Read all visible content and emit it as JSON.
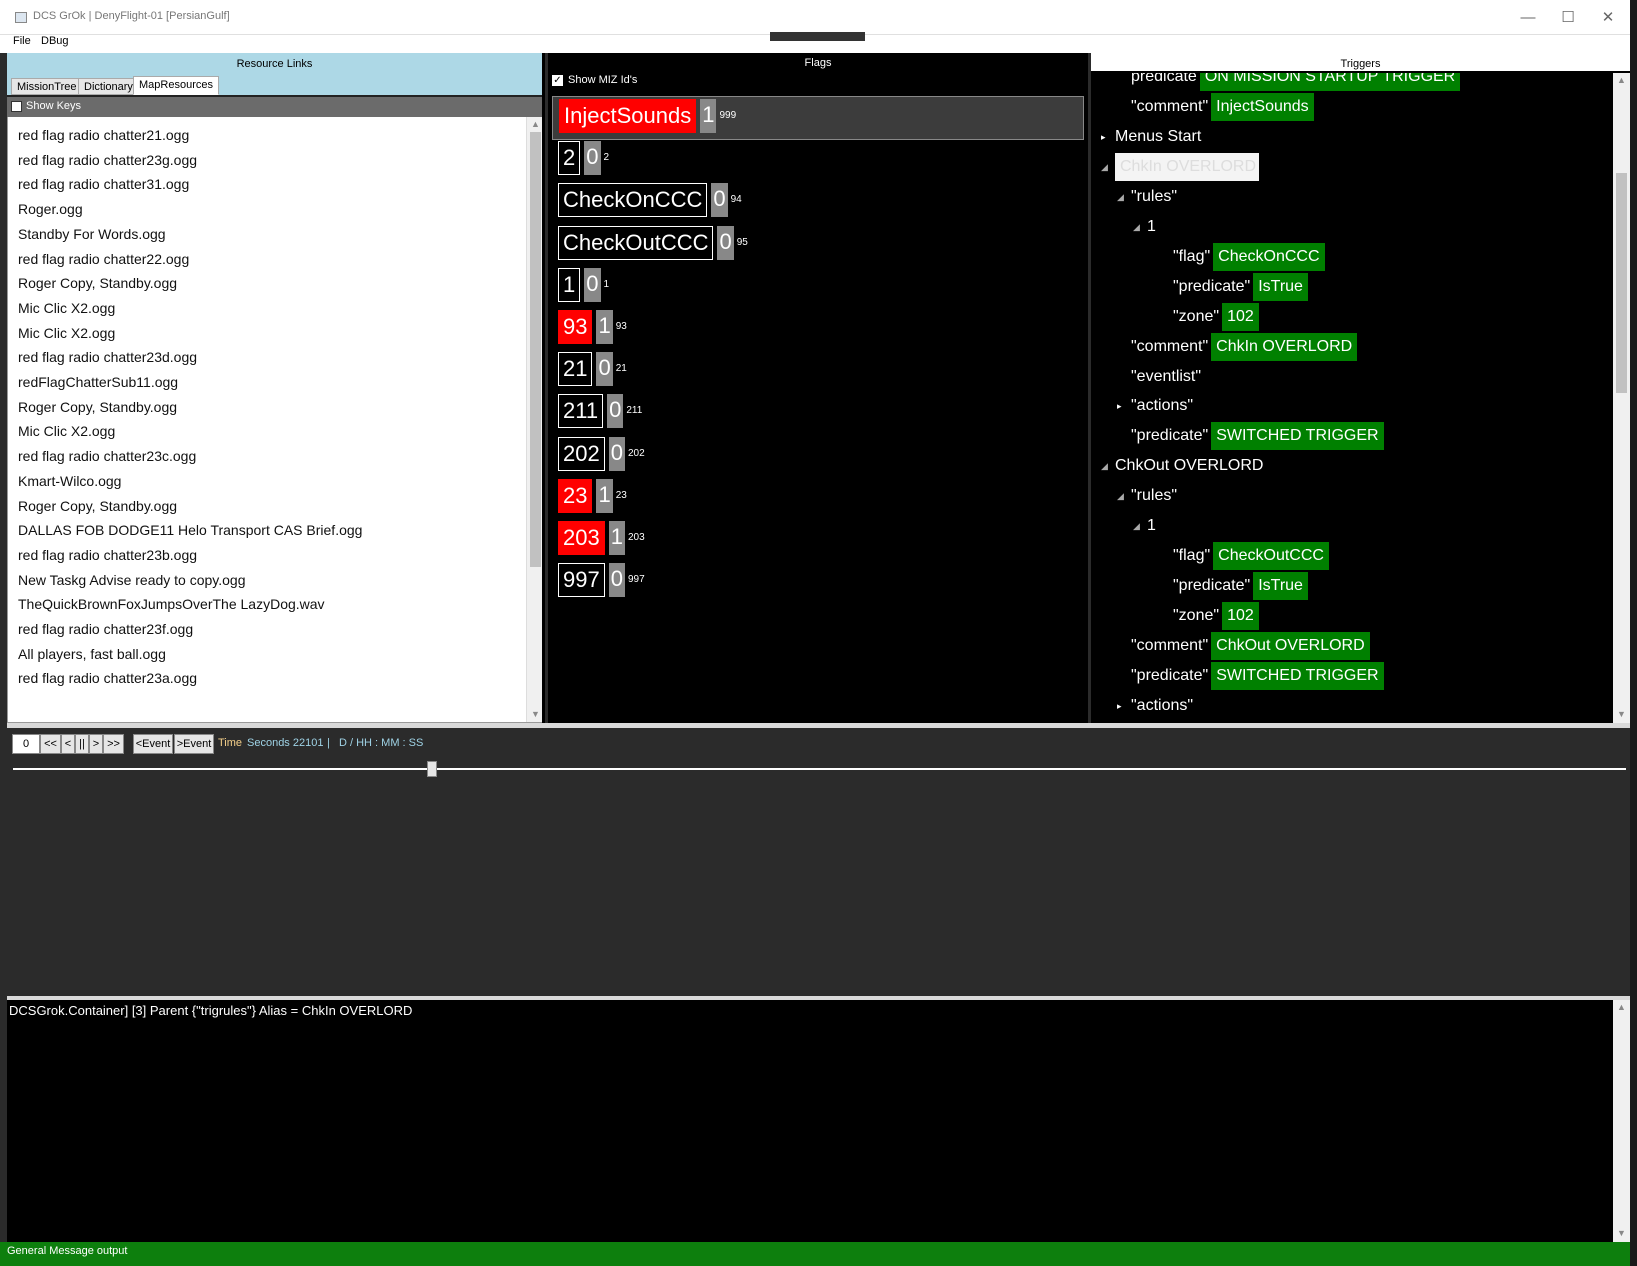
{
  "window": {
    "title": "DCS GrOk | DenyFlight-01 [PersianGulf]",
    "min_glyph": "—",
    "max_glyph": "☐",
    "close_glyph": "✕"
  },
  "menu": {
    "file": "File",
    "dbug": "DBug"
  },
  "resources": {
    "header": "Resource Links",
    "tabs": [
      "MissionTree",
      "Dictionary",
      "MapResources"
    ],
    "active_tab": "MapResources",
    "show_keys_label": "Show Keys",
    "items": [
      "red flag radio chatter21.ogg",
      "red flag radio chatter23g.ogg",
      "red flag radio chatter31.ogg",
      "Roger.ogg",
      "Standby For Words.ogg",
      "red flag radio chatter22.ogg",
      "Roger Copy, Standby.ogg",
      "Mic Clic X2.ogg",
      "Mic Clic X2.ogg",
      "red flag radio chatter23d.ogg",
      "redFlagChatterSub11.ogg",
      "Roger Copy, Standby.ogg",
      "Mic Clic X2.ogg",
      "red flag radio chatter23c.ogg",
      "Kmart-Wilco.ogg",
      "Roger Copy, Standby.ogg",
      "DALLAS FOB DODGE11 Helo Transport CAS Brief.ogg",
      "red flag radio chatter23b.ogg",
      "New Taskg Advise ready to copy.ogg",
      "TheQuickBrownFoxJumpsOverThe LazyDog.wav",
      "red flag radio chatter23f.ogg",
      "All players, fast ball.ogg",
      "red flag radio chatter23a.ogg"
    ]
  },
  "flags": {
    "header": "Flags",
    "show_miz_label": "Show MIZ Id's",
    "show_miz_checked": true,
    "rows": [
      {
        "name": "InjectSounds",
        "value": "1",
        "id": "999",
        "red": true
      },
      {
        "name": "2",
        "value": "0",
        "id": "2",
        "red": false
      },
      {
        "name": "CheckOnCCC",
        "value": "0",
        "id": "94",
        "red": false
      },
      {
        "name": "CheckOutCCC",
        "value": "0",
        "id": "95",
        "red": false
      },
      {
        "name": "1",
        "value": "0",
        "id": "1",
        "red": false
      },
      {
        "name": "93",
        "value": "1",
        "id": "93",
        "red": true
      },
      {
        "name": "21",
        "value": "0",
        "id": "21",
        "red": false
      },
      {
        "name": "211",
        "value": "0",
        "id": "211",
        "red": false
      },
      {
        "name": "202",
        "value": "0",
        "id": "202",
        "red": false
      },
      {
        "name": "23",
        "value": "1",
        "id": "23",
        "red": true
      },
      {
        "name": "203",
        "value": "1",
        "id": "203",
        "red": true
      },
      {
        "name": "997",
        "value": "0",
        "id": "997",
        "red": false
      }
    ]
  },
  "triggers": {
    "header": "Triggers",
    "nodes": [
      {
        "key": "predicate",
        "value": "ON MISSION STARTUP TRIGGER",
        "indent": 1,
        "arrow": ""
      },
      {
        "key": "\"comment\"",
        "value": "InjectSounds",
        "indent": 1,
        "arrow": ""
      },
      {
        "key": "Menus Start",
        "value": null,
        "indent": 0,
        "arrow": "▸"
      },
      {
        "key": "ChkIn OVERLORD",
        "value": null,
        "indent": 0,
        "arrow": "◢",
        "selected": true
      },
      {
        "key": "\"rules\"",
        "value": null,
        "indent": 1,
        "arrow": "◢"
      },
      {
        "key": "1",
        "value": null,
        "indent": 2,
        "arrow": "◢"
      },
      {
        "key": "\"flag\"",
        "value": "CheckOnCCC",
        "indent": 3,
        "arrow": ""
      },
      {
        "key": "\"predicate\"",
        "value": "IsTrue",
        "indent": 3,
        "arrow": ""
      },
      {
        "key": "\"zone\"",
        "value": "102",
        "indent": 3,
        "arrow": ""
      },
      {
        "key": "\"comment\"",
        "value": "ChkIn OVERLORD",
        "indent": 1,
        "arrow": ""
      },
      {
        "key": "\"eventlist\"",
        "value": "",
        "indent": 1,
        "arrow": ""
      },
      {
        "key": "\"actions\"",
        "value": null,
        "indent": 1,
        "arrow": "▸"
      },
      {
        "key": "\"predicate\"",
        "value": "SWITCHED TRIGGER",
        "indent": 1,
        "arrow": ""
      },
      {
        "key": "ChkOut OVERLORD",
        "value": null,
        "indent": 0,
        "arrow": "◢"
      },
      {
        "key": "\"rules\"",
        "value": null,
        "indent": 1,
        "arrow": "◢"
      },
      {
        "key": "1",
        "value": null,
        "indent": 2,
        "arrow": "◢"
      },
      {
        "key": "\"flag\"",
        "value": "CheckOutCCC",
        "indent": 3,
        "arrow": ""
      },
      {
        "key": "\"predicate\"",
        "value": "IsTrue",
        "indent": 3,
        "arrow": ""
      },
      {
        "key": "\"zone\"",
        "value": "102",
        "indent": 3,
        "arrow": ""
      },
      {
        "key": "\"comment\"",
        "value": "ChkOut OVERLORD",
        "indent": 1,
        "arrow": ""
      },
      {
        "key": "\"predicate\"",
        "value": "SWITCHED TRIGGER",
        "indent": 1,
        "arrow": ""
      },
      {
        "key": "\"actions\"",
        "value": null,
        "indent": 1,
        "arrow": "▸"
      }
    ]
  },
  "timeline": {
    "zero": "0",
    "rewind": "<<",
    "prev": "<",
    "pause": "||",
    "next": ">",
    "ffwd": ">>",
    "prev_event": "<Event",
    "next_event": ">Event",
    "time_label": "Time",
    "seconds_label": "Seconds 22101",
    "sep": "|",
    "dhms": "D  /  HH  :  MM  :  SS",
    "slider_position": 0.26
  },
  "output": {
    "message": "DCSGrok.Container] [3] Parent {\"trigrules\"} Alias = ChkIn OVERLORD",
    "status": "General Message output"
  },
  "colors": {
    "flag_on": "#ff0000",
    "trigger_value_bg": "#008000",
    "status_bar": "#0d7f0d",
    "resource_header": "#add8e6"
  }
}
